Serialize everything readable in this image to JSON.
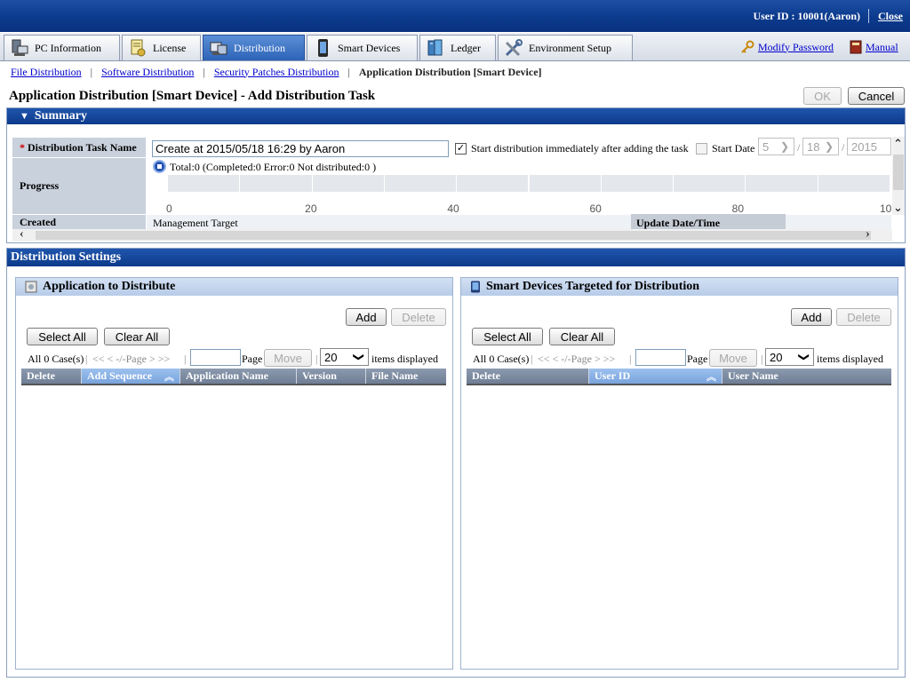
{
  "header": {
    "user_id_text": "User ID : 10001(Aaron)",
    "close_label": "Close"
  },
  "tabs": [
    {
      "label": "PC Information",
      "icon": "pc-info-icon",
      "active": false
    },
    {
      "label": "License",
      "icon": "license-icon",
      "active": false
    },
    {
      "label": "Distribution",
      "icon": "distribution-icon",
      "active": true
    },
    {
      "label": "Smart Devices",
      "icon": "smart-device-icon",
      "active": false
    },
    {
      "label": "Ledger",
      "icon": "ledger-icon",
      "active": false
    },
    {
      "label": "Environment Setup",
      "icon": "environment-setup-icon",
      "active": false
    }
  ],
  "header_links": {
    "modify_password": "Modify Password",
    "manual": "Manual"
  },
  "subnav": {
    "file_distribution": "File Distribution",
    "software_distribution": "Software Distribution",
    "security_patches": "Security Patches Distribution",
    "current": "Application Distribution [Smart Device]"
  },
  "page": {
    "title": "Application Distribution [Smart Device] - Add Distribution Task",
    "ok_label": "OK",
    "cancel_label": "Cancel"
  },
  "summary": {
    "header": "Summary",
    "task_name_label": "Distribution Task Name",
    "required_mark": "*",
    "task_name_value": "Create at 2015/05/18 16:29 by Aaron",
    "start_immediately_label": "Start distribution immediately after adding the task",
    "start_immediately_checked": true,
    "start_date_label": "Start Date",
    "start_month": "5",
    "start_day": "18",
    "start_year": "2015",
    "date_sep": "/",
    "progress_label": "Progress",
    "progress_text": "Total:0  (Completed:0  Error:0  Not distributed:0 )",
    "progress_value": 0,
    "progress_ticks": [
      "0",
      "20",
      "40",
      "60",
      "80",
      "10"
    ],
    "created_label": "Created",
    "management_target_label": "Management Target",
    "update_datetime_label": "Update Date/Time"
  },
  "dist_settings": {
    "header": "Distribution Settings",
    "left": {
      "title": "Application to Distribute",
      "add": "Add",
      "delete": "Delete",
      "select_all": "Select All",
      "clear_all": "Clear All",
      "case_count": "All 0 Case(s)",
      "pager_nav": "<< < -/-Page > >>",
      "page_label": "Page",
      "move": "Move",
      "per_page": "20",
      "items_displayed": "items displayed",
      "columns": [
        "Delete",
        "Add Sequence",
        "Application Name",
        "Version",
        "File Name"
      ]
    },
    "right": {
      "title": "Smart Devices Targeted for Distribution",
      "add": "Add",
      "delete": "Delete",
      "select_all": "Select All",
      "clear_all": "Clear All",
      "case_count": "All 0 Case(s)",
      "pager_nav": "<< < -/-Page > >>",
      "page_label": "Page",
      "move": "Move",
      "per_page": "20",
      "items_displayed": "items displayed",
      "columns": [
        "Delete",
        "User ID",
        "User Name"
      ]
    }
  }
}
